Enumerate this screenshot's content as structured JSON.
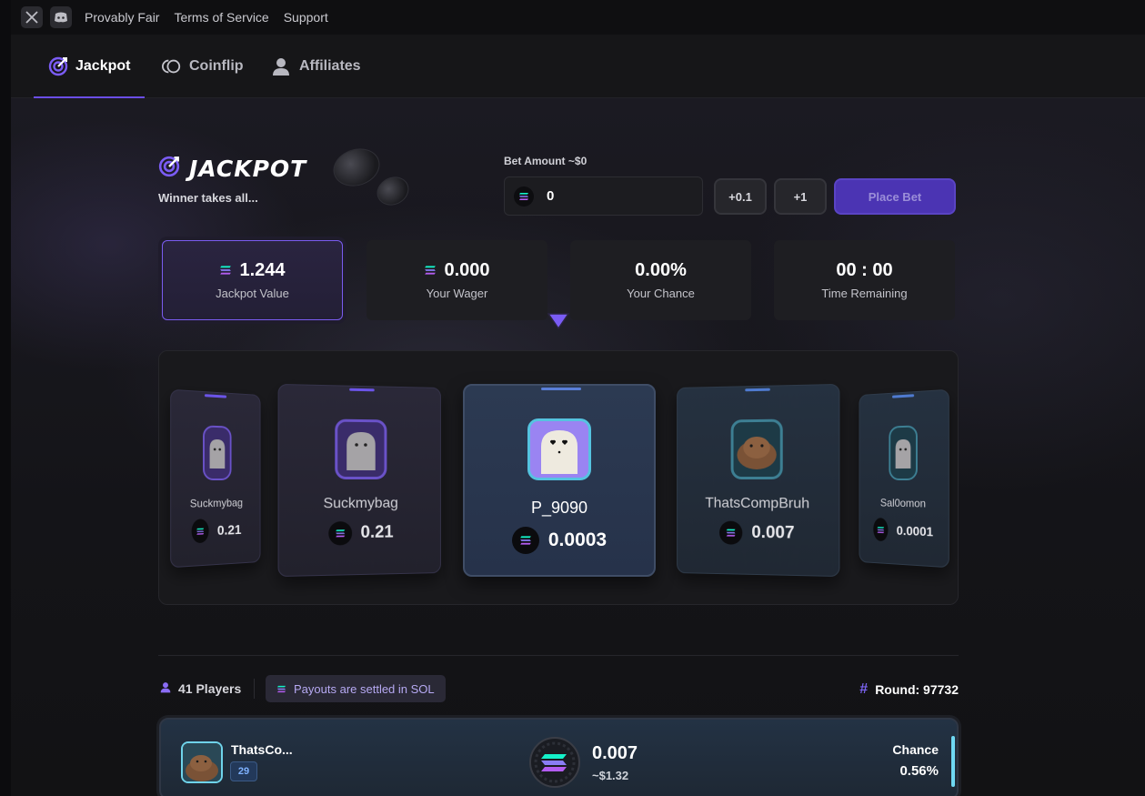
{
  "topbar": {
    "links": [
      "Provably Fair",
      "Terms of Service",
      "Support"
    ]
  },
  "nav": {
    "tabs": [
      {
        "label": "Jackpot",
        "icon": "target-icon",
        "active": true
      },
      {
        "label": "Coinflip",
        "icon": "coin-icon",
        "active": false
      },
      {
        "label": "Affiliates",
        "icon": "user-icon",
        "active": false
      }
    ]
  },
  "header": {
    "title": "JACKPOT",
    "subtitle": "Winner takes all..."
  },
  "bet": {
    "label": "Bet Amount ~$0",
    "value": "0",
    "quick1": "+0.1",
    "quick2": "+1",
    "place_label": "Place Bet"
  },
  "stats": {
    "jackpot_value": "1.244",
    "jackpot_label": "Jackpot Value",
    "wager_value": "0.000",
    "wager_label": "Your Wager",
    "chance_value": "0.00%",
    "chance_label": "Your Chance",
    "time_value": "00 : 00",
    "time_label": "Time Remaining"
  },
  "reel": {
    "cards": [
      {
        "name": "Suckmybag",
        "amount": "0.21",
        "avatar": "ghost"
      },
      {
        "name": "Suckmybag",
        "amount": "0.21",
        "avatar": "ghost"
      },
      {
        "name": "P_9090",
        "amount": "0.0003",
        "avatar": "ghost-love"
      },
      {
        "name": "ThatsCompBruh",
        "amount": "0.007",
        "avatar": "capybara"
      },
      {
        "name": "Sal0omon",
        "amount": "0.0001",
        "avatar": "ghost"
      }
    ]
  },
  "info": {
    "players": "41 Players",
    "payout_note": "Payouts are settled in SOL",
    "round": "Round: 97732"
  },
  "entry": {
    "name": "ThatsCo...",
    "level": "29",
    "amount": "0.007",
    "usd": "~$1.32",
    "chance_label": "Chance",
    "chance": "0.56%"
  },
  "colors": {
    "accent": "#6b4ee6",
    "place_bet": "#4b34b3",
    "entry_highlight": "#6fd8f2"
  }
}
